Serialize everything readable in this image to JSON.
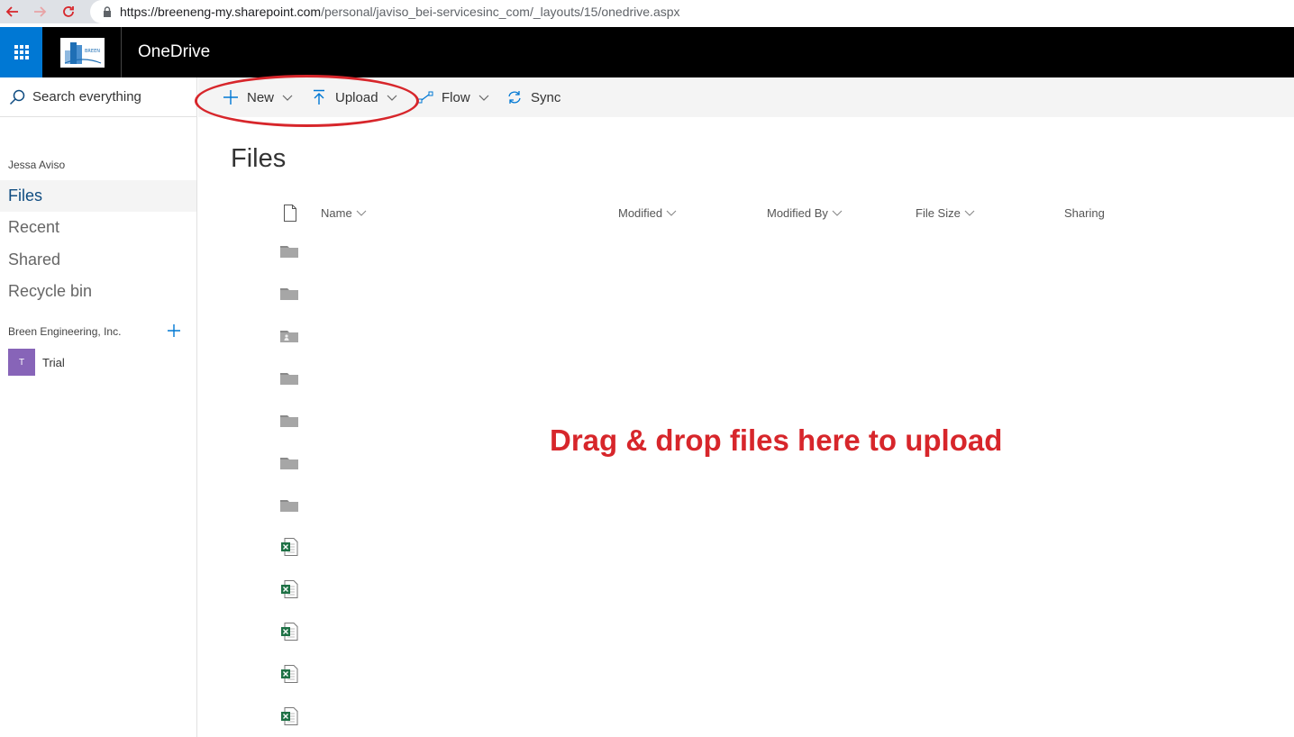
{
  "browser": {
    "url_host": "https://breeneng-my.sharepoint.com",
    "url_path": "/personal/javiso_bei-servicesinc_com/_layouts/15/onedrive.aspx"
  },
  "suite": {
    "app_title": "OneDrive",
    "accent_color": "#0078d4",
    "logo_text": "BREEN"
  },
  "nav": {
    "search_placeholder": "Search everything",
    "user_name": "Jessa Aviso",
    "items": [
      {
        "label": "Files",
        "active": true
      },
      {
        "label": "Recent",
        "active": false
      },
      {
        "label": "Shared",
        "active": false
      },
      {
        "label": "Recycle bin",
        "active": false
      }
    ],
    "org_name": "Breen Engineering, Inc.",
    "sites": [
      {
        "initial": "T",
        "label": "Trial",
        "color": "#8764b8"
      }
    ]
  },
  "commands": {
    "new_label": "New",
    "upload_label": "Upload",
    "flow_label": "Flow",
    "sync_label": "Sync"
  },
  "main": {
    "title": "Files",
    "columns": {
      "name": "Name",
      "modified": "Modified",
      "modified_by": "Modified By",
      "file_size": "File Size",
      "sharing": "Sharing"
    },
    "rows": [
      {
        "icon": "folder-icon"
      },
      {
        "icon": "folder-icon"
      },
      {
        "icon": "shared-folder-icon"
      },
      {
        "icon": "folder-icon"
      },
      {
        "icon": "folder-icon"
      },
      {
        "icon": "folder-icon"
      },
      {
        "icon": "folder-icon"
      },
      {
        "icon": "excel-file-icon"
      },
      {
        "icon": "excel-file-icon"
      },
      {
        "icon": "excel-file-icon"
      },
      {
        "icon": "excel-file-icon"
      },
      {
        "icon": "excel-file-icon"
      }
    ],
    "drop_message": "Drag & drop files here to upload",
    "annotation_color": "#d7262b"
  }
}
